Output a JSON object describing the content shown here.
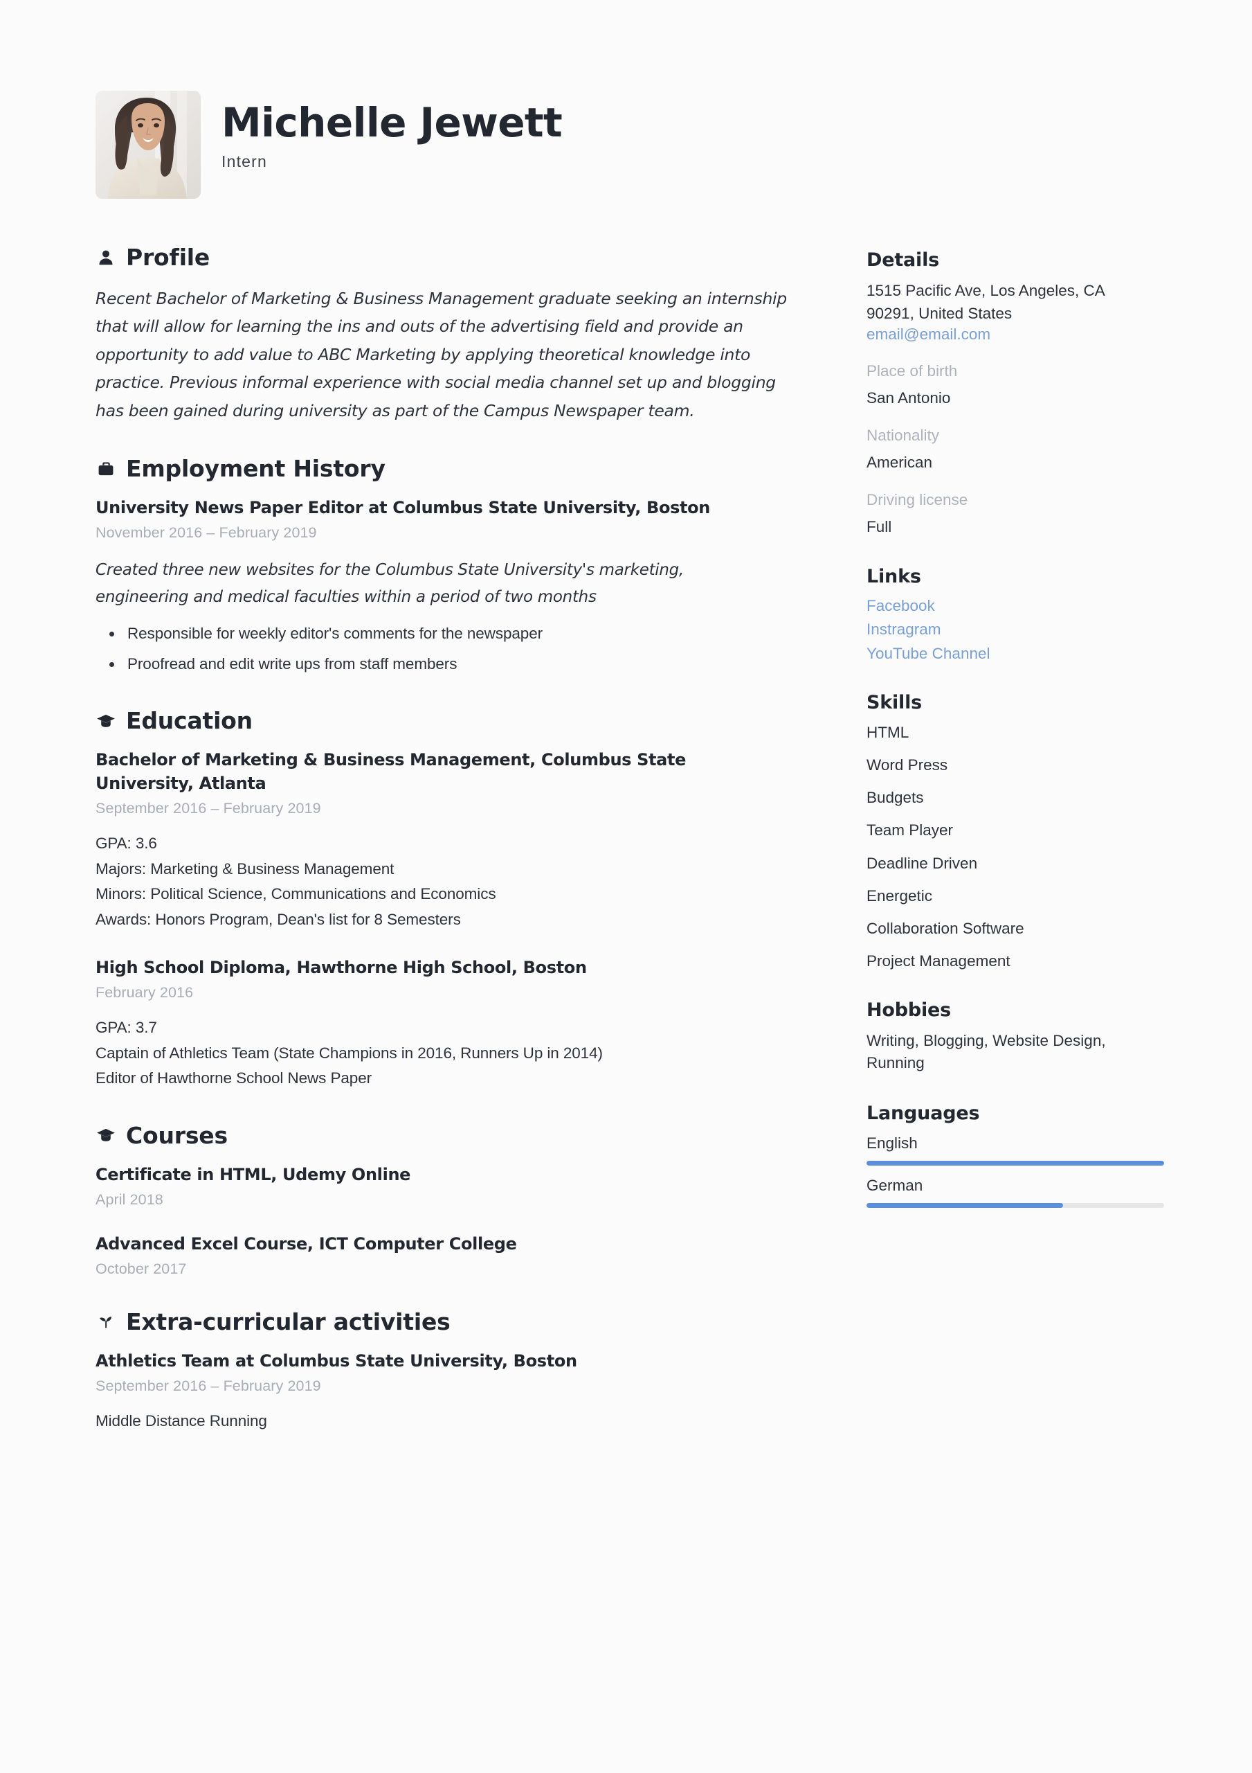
{
  "header": {
    "name": "Michelle Jewett",
    "job_title": "Intern",
    "avatar_alt": "portrait-photo"
  },
  "accent_colors": {
    "link_blue": "#7a9fd4",
    "bar_blue": "#5b8fd9",
    "bar_track": "#e6e6e6",
    "muted_gray": "#aeb2ba",
    "text_dark": "#23272f",
    "page_bg": "#fbfbfb"
  },
  "main": {
    "profile": {
      "title": "Profile",
      "icon": "person-icon",
      "summary": "Recent Bachelor of Marketing & Business Management graduate seeking an internship that will allow for learning the ins and outs of the advertising field and provide an opportunity to add value to ABC Marketing by applying theoretical knowledge into practice. Previous informal experience with social media channel set up and blogging has been gained during university as part of the Campus Newspaper team."
    },
    "employment": {
      "title": "Employment History",
      "icon": "briefcase-icon",
      "entries": [
        {
          "title": "University News Paper Editor at Columbus State University, Boston",
          "date": "November 2016  –  February 2019",
          "description": "Created three new websites for the Columbus State University's marketing, engineering and medical faculties within a period of two months",
          "bullets": [
            "Responsible for weekly editor's comments for the newspaper",
            "Proofread and edit write ups from staff members"
          ]
        }
      ]
    },
    "education": {
      "title": "Education",
      "icon": "graduation-cap-icon",
      "entries": [
        {
          "title": "Bachelor of Marketing & Business Management, Columbus State University, Atlanta",
          "date": "September 2016  –  February 2019",
          "lines": [
            "GPA: 3.6",
            "Majors: Marketing & Business Management",
            "Minors: Political Science, Communications and Economics",
            "Awards: Honors Program, Dean's list for 8 Semesters"
          ]
        },
        {
          "title": "High School Diploma, Hawthorne High School, Boston",
          "date": "February 2016",
          "lines": [
            "GPA: 3.7",
            "Captain of Athletics Team (State Champions in 2016, Runners Up in 2014)",
            "Editor of Hawthorne School News Paper"
          ]
        }
      ]
    },
    "courses": {
      "title": "Courses",
      "icon": "graduation-cap-icon",
      "entries": [
        {
          "title": "Certificate in HTML, Udemy Online",
          "date": "April 2018"
        },
        {
          "title": "Advanced Excel Course, ICT Computer College",
          "date": "October 2017"
        }
      ]
    },
    "extracurricular": {
      "title": "Extra-curricular activities",
      "icon": "sprout-icon",
      "entries": [
        {
          "title": "Athletics Team at Columbus State University, Boston",
          "date": "September 2016  –  February 2019",
          "lines": [
            "Middle Distance Running"
          ]
        }
      ]
    }
  },
  "sidebar": {
    "details": {
      "title": "Details",
      "address_line1": "1515 Pacific Ave, Los Angeles, CA",
      "address_line2": "90291, United States",
      "email": "email@email.com",
      "fields": [
        {
          "label": "Place of birth",
          "value": "San Antonio"
        },
        {
          "label": "Nationality",
          "value": "American"
        },
        {
          "label": "Driving license",
          "value": "Full"
        }
      ]
    },
    "links": {
      "title": "Links",
      "items": [
        {
          "label": "Facebook"
        },
        {
          "label": "Instragram"
        },
        {
          "label": "YouTube Channel"
        }
      ]
    },
    "skills": {
      "title": "Skills",
      "items": [
        "HTML",
        "Word Press",
        "Budgets",
        "Team Player",
        "Deadline Driven",
        "Energetic",
        "Collaboration Software",
        "Project Management"
      ]
    },
    "hobbies": {
      "title": "Hobbies",
      "text": "Writing, Blogging, Website Design, Running"
    },
    "languages": {
      "title": "Languages",
      "items": [
        {
          "name": "English",
          "level_percent": 100
        },
        {
          "name": "German",
          "level_percent": 66
        }
      ]
    }
  }
}
